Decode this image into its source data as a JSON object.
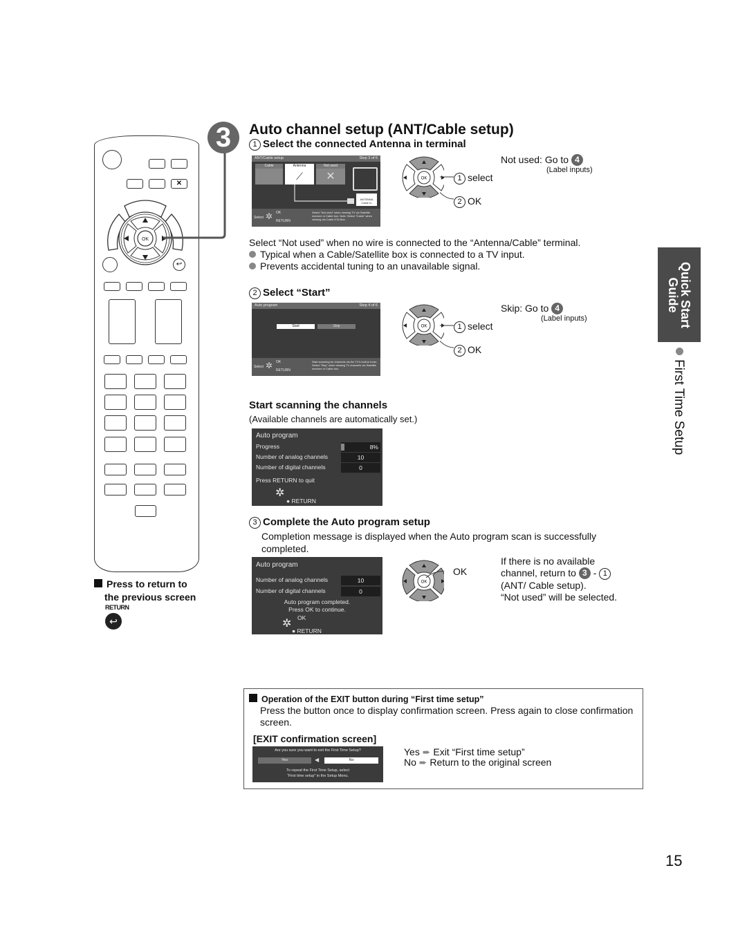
{
  "step": {
    "number": "3",
    "title": "Auto channel setup (ANT/Cable setup)"
  },
  "sub1": {
    "num": "1",
    "title": "Select the connected Antenna in terminal",
    "screen": {
      "header": "ANT/Cable setup",
      "step": "Step 3 of 6",
      "options": [
        "Cable",
        "Antenna",
        "Not used"
      ],
      "selected": "Antenna",
      "terminal_label": "ANTENNA Cable In",
      "footer_select": "Select",
      "footer_ok": "OK",
      "footer_return": "RETURN",
      "footer_note": "Select \"Not used\" when viewing TV via Satellite receiver or Cable box. Note: Select \"Cable\" when viewing via Cable DTA Box."
    },
    "dpad_ok": "OK",
    "select_label": "select",
    "ok_label": "OK",
    "not_used_text": "Not used: Go to",
    "goto_num": "4",
    "label_inputs": "(Label inputs)",
    "note": "Select “Not used” when no wire is connected to the “Antenna/Cable” terminal.",
    "bullets": [
      "Typical when a Cable/Satellite box is connected to a TV input.",
      "Prevents accidental tuning to an unavailable signal."
    ]
  },
  "sub2": {
    "num": "2",
    "title": "Select “Start”",
    "screen": {
      "header": "Auto program",
      "step": "Step 4 of 6",
      "start": "Start",
      "skip": "Skip",
      "footer_select": "Select",
      "footer_ok": "OK",
      "footer_return": "RETURN",
      "footer_note": "Start scanning for channels via the TV's built-in tuner. Select \"Skip\" when viewing TV channels via Satellite receiver or Cable box."
    },
    "select_label": "select",
    "ok_label": "OK",
    "skip_text": "Skip: Go to",
    "goto_num": "4",
    "label_inputs": "(Label inputs)"
  },
  "scanning": {
    "title": "Start scanning the channels",
    "subtitle": "(Available channels are automatically set.)",
    "screen": {
      "header": "Auto program",
      "progress_label": "Progress",
      "progress_value": "8%",
      "progress_fraction": 0.08,
      "analog_label": "Number of analog channels",
      "analog_value": "10",
      "digital_label": "Number of digital channels",
      "digital_value": "0",
      "quit_text": "Press RETURN to quit",
      "return_label": "RETURN"
    }
  },
  "sub3": {
    "num": "3",
    "title": "Complete the Auto program setup",
    "desc": "Completion message is displayed when the Auto program scan is successfully completed.",
    "screen": {
      "header": "Auto program",
      "analog_label": "Number of analog channels",
      "analog_value": "10",
      "digital_label": "Number of digital channels",
      "digital_value": "0",
      "msg1": "Auto program completed.",
      "msg2": "Press OK to continue.",
      "ok_label": "OK",
      "return_label": "RETURN"
    },
    "ok_label": "OK",
    "note_line1": "If there is no available",
    "note_line2": "channel, return to",
    "note_ref_step": "3",
    "note_ref_sub": "1",
    "note_line3": "(ANT/ Cable setup).",
    "note_line4": "“Not used” will be selected."
  },
  "return_note": {
    "line1": "Press to return to",
    "line2": "the previous screen",
    "button_label": "RETURN"
  },
  "exit_box": {
    "title": "Operation of the EXIT button during “First time setup”",
    "desc": "Press the button once to display confirmation screen. Press again to close confirmation screen.",
    "subtitle": "[EXIT confirmation screen]",
    "screen": {
      "question": "Are you sure you want to exit the First Time Setup?",
      "yes": "Yes",
      "no": "No",
      "hint1": "To repeat the First Time Setup, select",
      "hint2": "“First time setup” in the Setup Menu."
    },
    "yes_label": "Yes",
    "yes_text": "Exit “First time setup”",
    "no_label": "No",
    "no_text": "Return to the original screen"
  },
  "side_tab": {
    "line1": "Quick Start",
    "line2": "Guide",
    "section": "First Time Setup"
  },
  "page_number": "15"
}
